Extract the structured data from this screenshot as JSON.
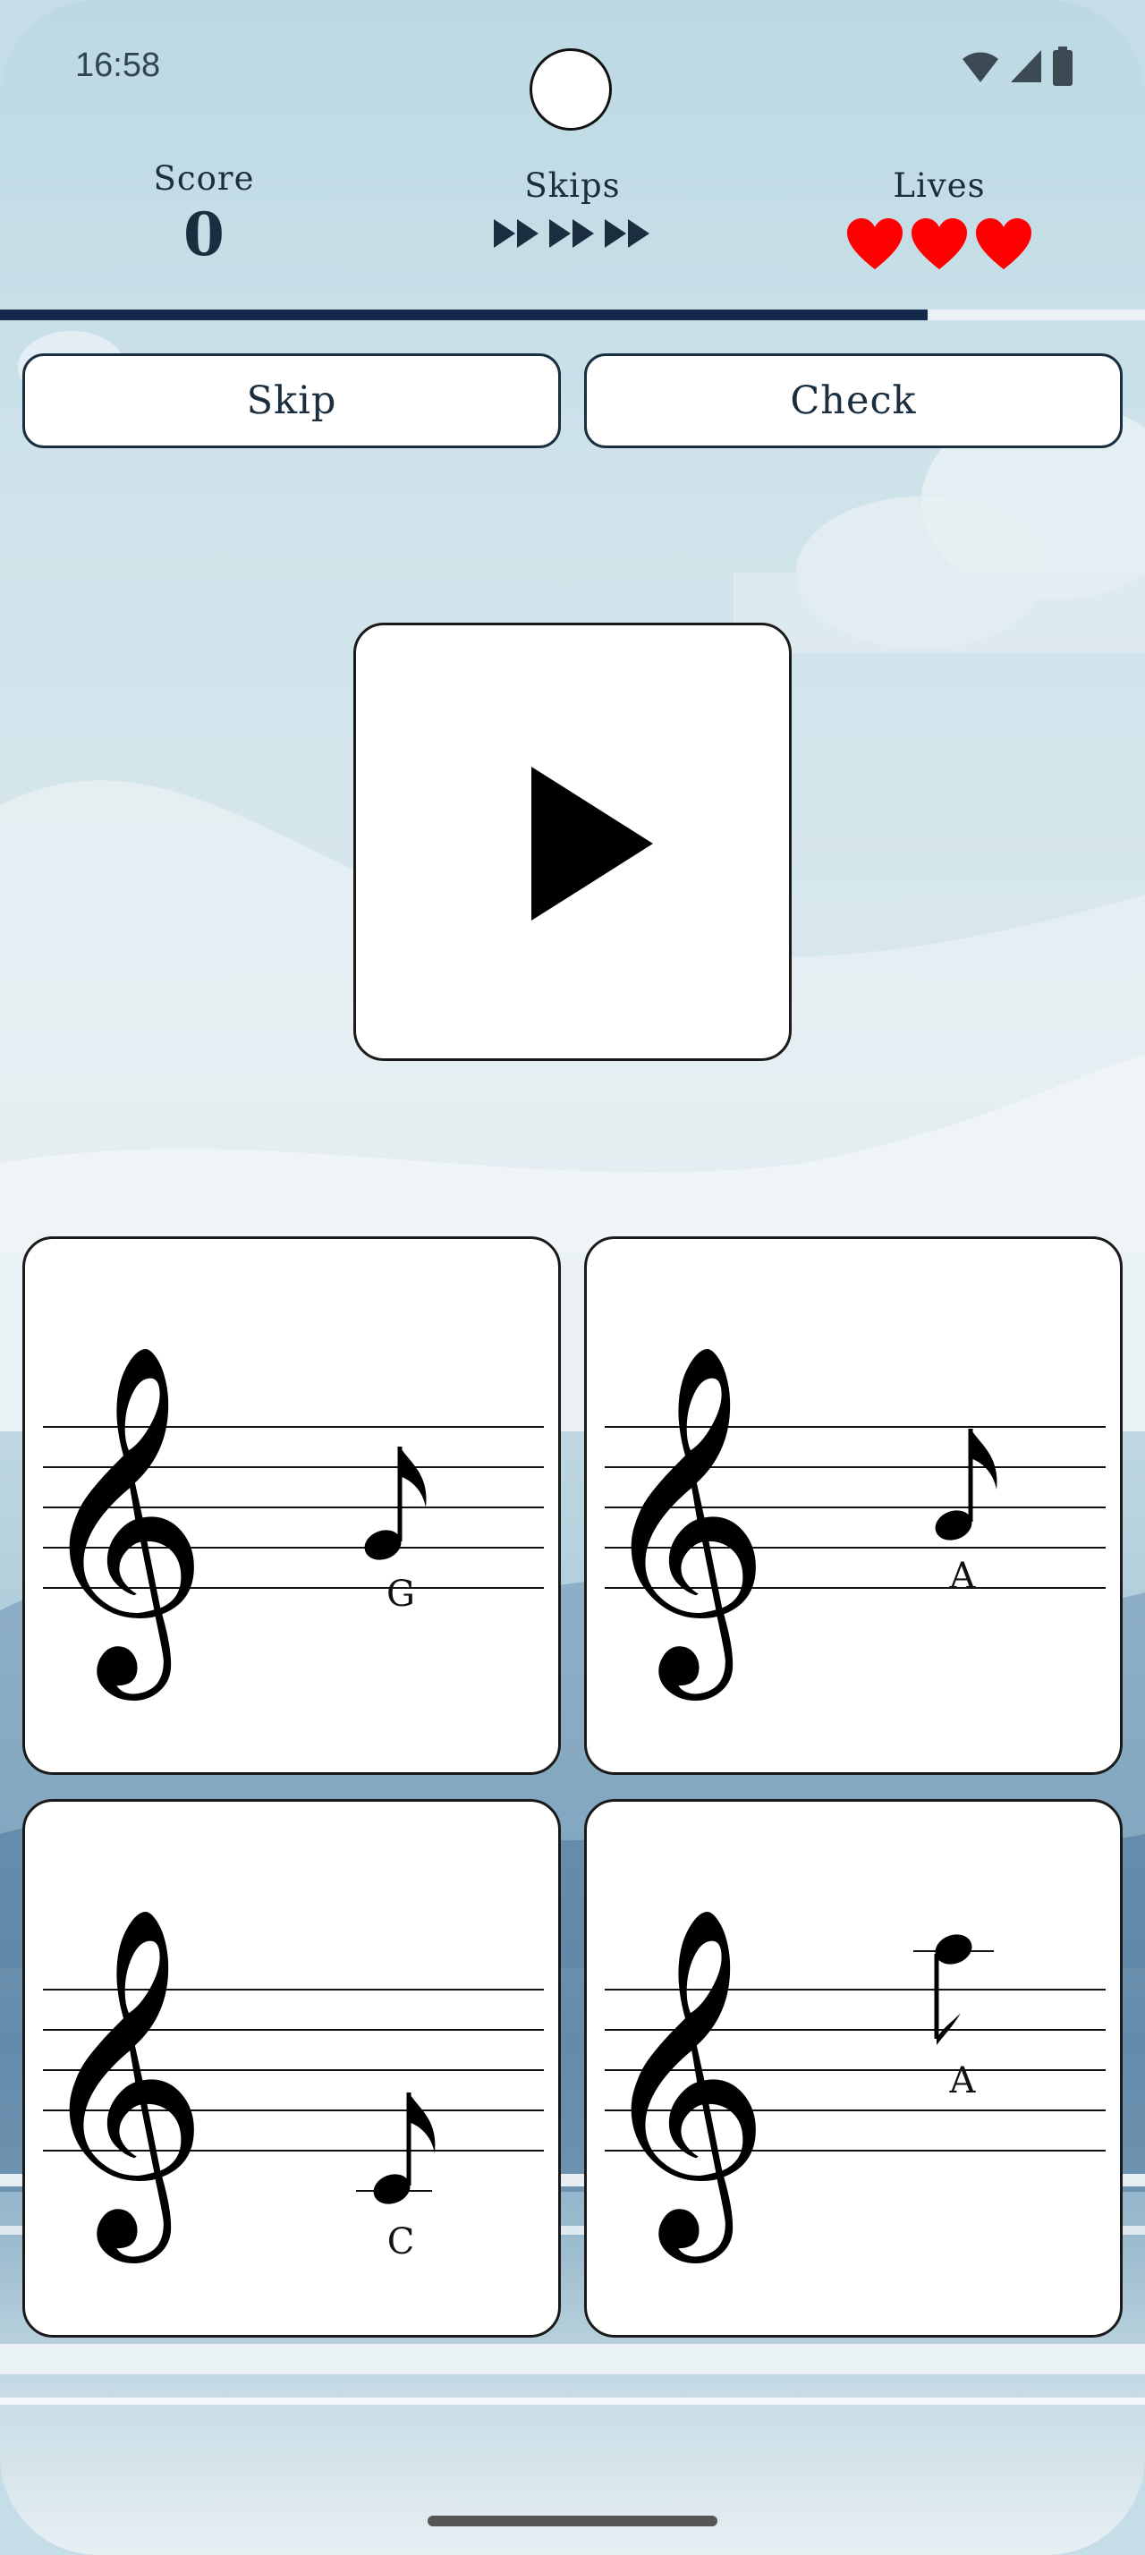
{
  "status_bar": {
    "time": "16:58",
    "icons": [
      "wifi-icon",
      "cell-signal-icon",
      "battery-icon"
    ]
  },
  "hud": {
    "score_label": "Score",
    "score_value": "0",
    "skips_label": "Skips",
    "skips_remaining": 3,
    "skips_icon": "fast-forward-icon",
    "lives_label": "Lives",
    "lives_remaining": 3,
    "lives_icon": "heart-icon"
  },
  "progress": {
    "fraction": 0.81
  },
  "actions": {
    "skip_label": "Skip",
    "check_label": "Check"
  },
  "play": {
    "icon": "play-icon"
  },
  "choices": [
    {
      "note": "G",
      "clef": "treble-clef-icon"
    },
    {
      "note": "A",
      "clef": "treble-clef-icon"
    },
    {
      "note": "C",
      "clef": "treble-clef-icon"
    },
    {
      "note": "A",
      "clef": "treble-clef-icon"
    }
  ],
  "colors": {
    "text": "#1a2e40",
    "heart": "#ff0000",
    "progress": "#13294b"
  }
}
